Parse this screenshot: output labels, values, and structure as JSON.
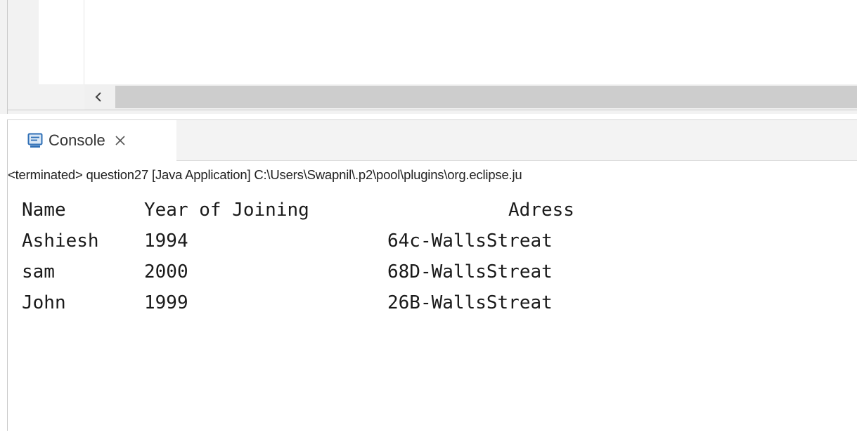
{
  "editor": {
    "scroll_left_icon": "chevron-left-icon"
  },
  "console": {
    "tab": {
      "icon": "console-icon",
      "label": "Console",
      "close_icon": "close-icon"
    },
    "status": "<terminated> question27 [Java Application] C:\\Users\\Swapnil\\.p2\\pool\\plugins\\org.eclipse.ju",
    "header": {
      "name": "Name",
      "year": "Year of Joining",
      "address": "Adress"
    },
    "rows": [
      {
        "name": "Ashiesh",
        "year": "1994",
        "address": "64c-WallsStreat"
      },
      {
        "name": "sam",
        "year": "2000",
        "address": "68D-WallsStreat"
      },
      {
        "name": "John",
        "year": "1999",
        "address": "26B-WallsStreat"
      }
    ]
  },
  "colors": {
    "console_icon_blue": "#2f6fb6",
    "scroll_thumb": "#cdcdcd"
  }
}
